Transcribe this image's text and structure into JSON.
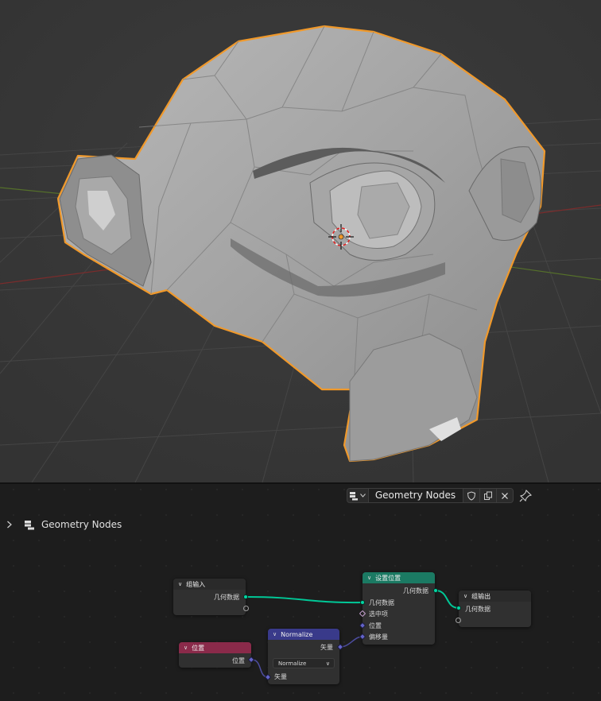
{
  "viewport": {
    "background": "#393939",
    "outline_color": "#f0992b",
    "x_axis_color": "#7a2c2c",
    "y_axis_color": "#5a7a2a",
    "object_icon": "suzanne-monkey-mesh"
  },
  "header": {
    "tree_type_icon": "node-tree-icon",
    "tree_name": "Geometry Nodes",
    "fake_user_icon": "shield-icon",
    "duplicate_icon": "copy-icon",
    "unlink_icon": "close-icon",
    "pin_icon": "pin-icon"
  },
  "breadcrumb": {
    "chevron_icon": "chevron-right-icon",
    "label": "Geometry Nodes"
  },
  "nodes": {
    "group_input": {
      "title": "组输入",
      "out_geometry": "几何数据",
      "header_color": "#2a2a2a"
    },
    "set_position": {
      "title": "设置位置",
      "header_color": "#1b7a63",
      "out_geometry": "几何数据",
      "in_geometry": "几何数据",
      "in_selection": "选中项",
      "in_position": "位置",
      "in_offset": "偏移量"
    },
    "group_output": {
      "title": "组输出",
      "in_geometry": "几何数据",
      "header_color": "#2a2a2a"
    },
    "position": {
      "title": "位置",
      "out_position": "位置",
      "header_color": "#8a2a4a"
    },
    "normalize": {
      "title": "Normalize",
      "header_color": "#393a8a",
      "out_vector": "矢量",
      "operation": "Normalize",
      "in_vector": "矢量"
    }
  },
  "colors": {
    "geometry_socket": "#00d6a3",
    "vector_socket": "#6363c7",
    "bool_socket": "#cca6d6"
  }
}
